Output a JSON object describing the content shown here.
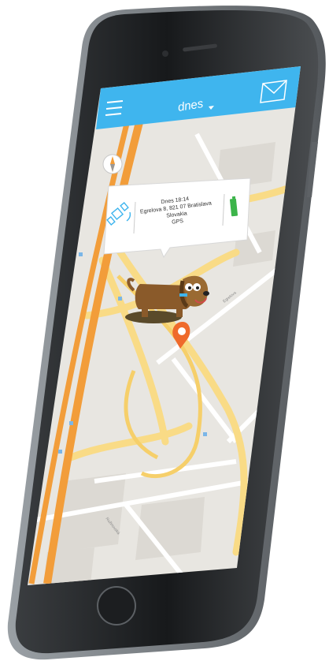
{
  "header": {
    "title": "dnes",
    "menu_icon": "hamburger-menu-icon",
    "dropdown_icon": "caret-down-icon",
    "mail_icon": "envelope-icon",
    "color": "#3fb5ee"
  },
  "popup": {
    "time": "Dnes 18:14",
    "address": "Egrelova 8, 821 07 Bratislava",
    "country": "Slovakia",
    "source": "GPS",
    "satellite_icon": "satellite-icon",
    "battery_icon": "battery-icon",
    "battery_color": "#3cb44a"
  },
  "map": {
    "compass_icon": "compass-icon",
    "pin_icon": "location-pin-icon",
    "pin_color": "#ef6a2b",
    "pet_icon": "dog-avatar",
    "road_labels": [
      "Egrelova",
      "Ružinovská"
    ]
  },
  "device": {
    "frame_color": "#222426",
    "home_button_icon": "home-button-icon"
  }
}
